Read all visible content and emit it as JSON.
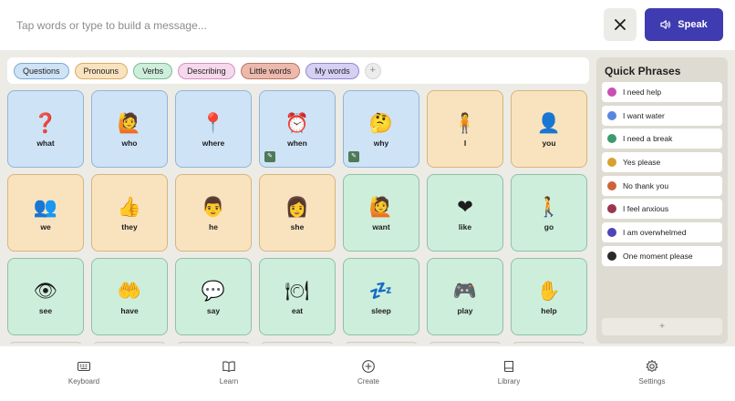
{
  "message_bar": {
    "placeholder": "Tap words or type to build a message...",
    "clear_icon": "close-icon",
    "speak_label": "Speak",
    "speak_icon": "speaker-icon"
  },
  "categories": [
    {
      "label": "Questions",
      "bg": "#cfe3f7",
      "border": "#7ea9d2"
    },
    {
      "label": "Pronouns",
      "bg": "#f9e3bf",
      "border": "#d9ad64"
    },
    {
      "label": "Verbs",
      "bg": "#cdeedb",
      "border": "#7cbb95"
    },
    {
      "label": "Describing",
      "bg": "#f6d8ec",
      "border": "#d592bd"
    },
    {
      "label": "Little words",
      "bg": "#ecb9ac",
      "border": "#bc7665"
    },
    {
      "label": "My words",
      "bg": "#d5d0f4",
      "border": "#9189d0"
    }
  ],
  "add_category_label": "+",
  "tiles": [
    {
      "emoji": "❓",
      "label": "what",
      "kind": "question"
    },
    {
      "emoji": "🙋",
      "label": "who",
      "kind": "question"
    },
    {
      "emoji": "📍",
      "label": "where",
      "kind": "question"
    },
    {
      "emoji": "⏰",
      "label": "when",
      "kind": "question",
      "badge": true
    },
    {
      "emoji": "🤔",
      "label": "why",
      "kind": "question",
      "badge": true
    },
    {
      "emoji": "🧍",
      "label": "I",
      "kind": "pronoun"
    },
    {
      "emoji": "👤",
      "label": "you",
      "kind": "pronoun"
    },
    {
      "emoji": "👥",
      "label": "we",
      "kind": "pronoun"
    },
    {
      "emoji": "👍",
      "label": "they",
      "kind": "pronoun"
    },
    {
      "emoji": "👨",
      "label": "he",
      "kind": "pronoun"
    },
    {
      "emoji": "👩",
      "label": "she",
      "kind": "pronoun"
    },
    {
      "emoji": "🙋",
      "label": "want",
      "kind": "verb"
    },
    {
      "emoji": "❤",
      "label": "like",
      "kind": "verb"
    },
    {
      "emoji": "🚶",
      "label": "go",
      "kind": "verb"
    },
    {
      "emoji": "👁",
      "label": "see",
      "kind": "verb"
    },
    {
      "emoji": "🤲",
      "label": "have",
      "kind": "verb"
    },
    {
      "emoji": "💬",
      "label": "say",
      "kind": "verb"
    },
    {
      "emoji": "🍽",
      "label": "eat",
      "kind": "verb"
    },
    {
      "emoji": "💤",
      "label": "sleep",
      "kind": "verb"
    },
    {
      "emoji": "🎮",
      "label": "play",
      "kind": "verb"
    },
    {
      "emoji": "✋",
      "label": "help",
      "kind": "verb"
    }
  ],
  "tile_colors": {
    "question": {
      "bg": "#cfe3f7",
      "border": "#91b5d6"
    },
    "pronoun": {
      "bg": "#f9e3bf",
      "border": "#d8b57b"
    },
    "verb": {
      "bg": "#cdeedb",
      "border": "#8fc2a2"
    }
  },
  "quick_phrases": {
    "title": "Quick Phrases",
    "items": [
      {
        "text": "I need help",
        "color": "#c94fb0"
      },
      {
        "text": "I want water",
        "color": "#5a86e0"
      },
      {
        "text": "I need a break",
        "color": "#3e9a6c"
      },
      {
        "text": "Yes please",
        "color": "#d9a032"
      },
      {
        "text": "No thank you",
        "color": "#d0623a"
      },
      {
        "text": "I feel anxious",
        "color": "#9b3550"
      },
      {
        "text": "I am overwhelmed",
        "color": "#4f45b8"
      },
      {
        "text": "One moment please",
        "color": "#2a2a2a"
      }
    ],
    "add_label": "+"
  },
  "bottom_nav": [
    {
      "label": "Keyboard",
      "icon": "keyboard-icon"
    },
    {
      "label": "Learn",
      "icon": "book-open-icon"
    },
    {
      "label": "Create",
      "icon": "plus-circle-icon"
    },
    {
      "label": "Library",
      "icon": "book-icon"
    },
    {
      "label": "Settings",
      "icon": "gear-icon"
    }
  ]
}
